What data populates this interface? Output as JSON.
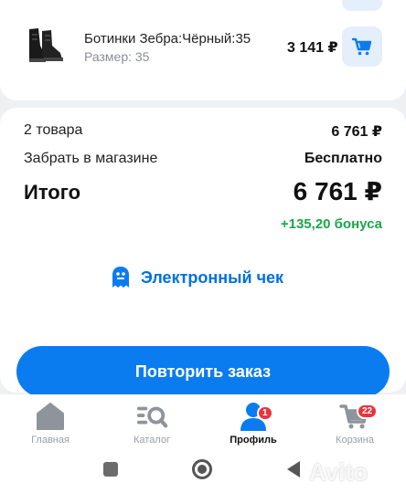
{
  "product": {
    "name": "Ботинки Зебра:Чёрный:35",
    "size": "Размер: 35",
    "price": "3 141 ₽"
  },
  "summary": {
    "items_label": "2 товара",
    "items_value": "6 761 ₽",
    "pickup_label": "Забрать в магазине",
    "pickup_value": "Бесплатно",
    "total_label": "Итого",
    "total_value": "6 761 ₽",
    "bonus": "+135,20 бонуса"
  },
  "receipt": {
    "label": "Электронный чек"
  },
  "actions": {
    "repeat_order": "Повторить заказ"
  },
  "nav": {
    "items": [
      {
        "label": "Главная",
        "icon": "home-icon"
      },
      {
        "label": "Каталог",
        "icon": "catalog-search-icon"
      },
      {
        "label": "Профиль",
        "icon": "profile-icon",
        "badge": "1",
        "active": true
      },
      {
        "label": "Корзина",
        "icon": "cart-icon",
        "badge": "22"
      }
    ]
  },
  "watermark": "Avito",
  "colors": {
    "accent": "#0a7cf0",
    "bonus": "#1aa64a",
    "badge": "#e8343f",
    "background": "#eef0f2"
  }
}
